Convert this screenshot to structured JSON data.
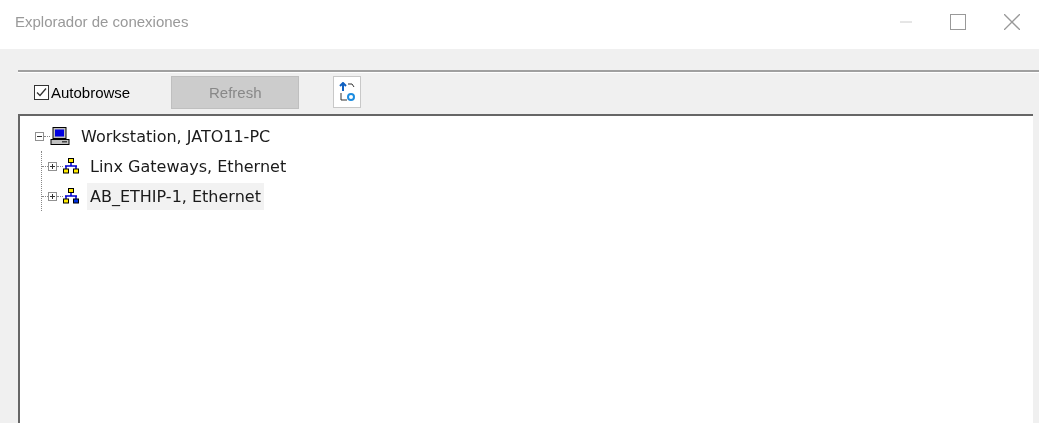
{
  "window": {
    "title": "Explorador de conexiones"
  },
  "toolbar": {
    "autobrowse": {
      "label": "Autobrowse",
      "checked": true
    },
    "refresh": {
      "label": "Refresh",
      "disabled": true
    }
  },
  "tree": [
    {
      "label": "Workstation, JATO11-PC",
      "kind": "workstation",
      "expanded": true,
      "selected": false,
      "children": [
        {
          "label": "Linx Gateways, Ethernet",
          "kind": "gateway",
          "expanded": false,
          "selected": false
        },
        {
          "label": "AB_ETHIP-1, Ethernet",
          "kind": "driver",
          "expanded": false,
          "selected": true
        }
      ]
    }
  ]
}
